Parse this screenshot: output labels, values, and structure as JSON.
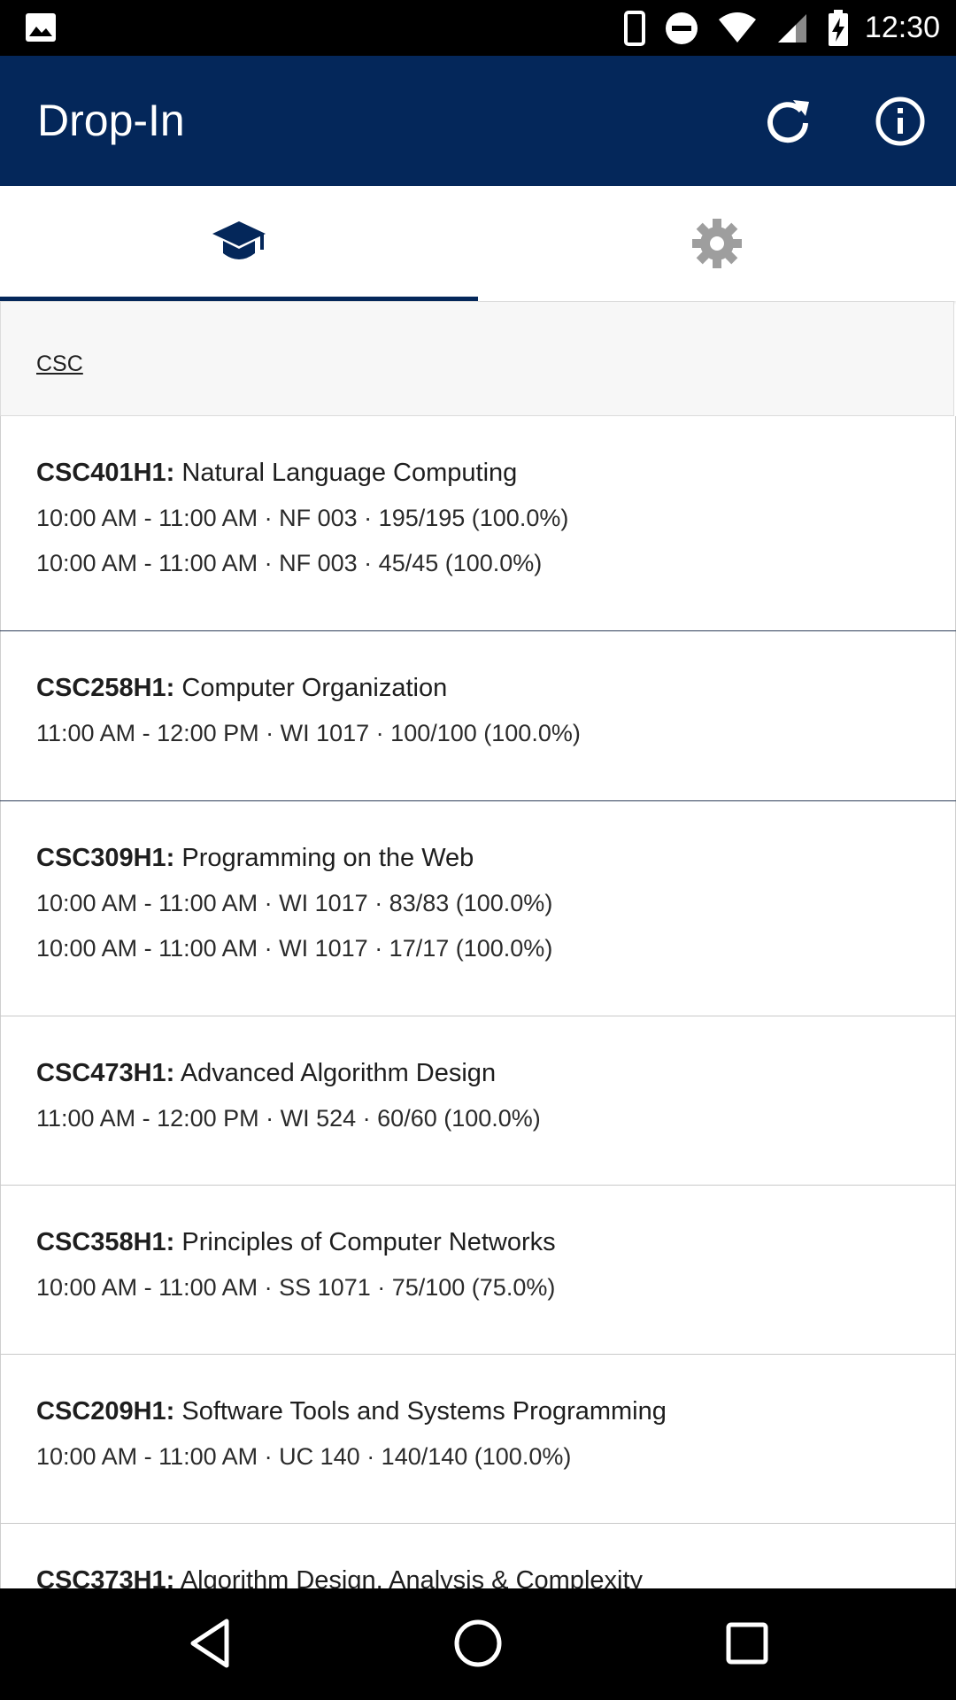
{
  "status_bar": {
    "time": "12:30",
    "icons": [
      "gallery-icon",
      "phone-icon",
      "do-not-disturb-icon",
      "wifi-icon",
      "signal-icon",
      "battery-charging-icon"
    ]
  },
  "app_bar": {
    "title": "Drop-In",
    "actions": [
      "refresh-icon",
      "info-icon"
    ],
    "color": "#04275a"
  },
  "tabs": [
    {
      "icon": "graduation-cap-icon",
      "selected": true
    },
    {
      "icon": "gear-icon",
      "selected": false
    }
  ],
  "section": {
    "label": "CSC"
  },
  "courses": [
    {
      "code": "CSC401H1:",
      "name": "Natural Language Computing",
      "sessions": [
        "10:00 AM - 11:00 AM · NF 003 · 195/195 (100.0%)",
        "10:00 AM - 11:00 AM · NF 003 · 45/45 (100.0%)"
      ]
    },
    {
      "code": "CSC258H1:",
      "name": "Computer Organization",
      "sessions": [
        "11:00 AM - 12:00 PM · WI 1017 · 100/100 (100.0%)"
      ]
    },
    {
      "code": "CSC309H1:",
      "name": "Programming on the Web",
      "sessions": [
        "10:00 AM - 11:00 AM · WI 1017 · 83/83 (100.0%)",
        "10:00 AM - 11:00 AM · WI 1017 · 17/17 (100.0%)"
      ]
    },
    {
      "code": "CSC473H1:",
      "name": "Advanced Algorithm Design",
      "sessions": [
        "11:00 AM - 12:00 PM · WI 524 · 60/60 (100.0%)"
      ]
    },
    {
      "code": "CSC358H1:",
      "name": "Principles of Computer Networks",
      "sessions": [
        "10:00 AM - 11:00 AM · SS 1071 · 75/100 (75.0%)"
      ]
    },
    {
      "code": "CSC209H1:",
      "name": "Software Tools and Systems Programming",
      "sessions": [
        "10:00 AM - 11:00 AM · UC 140 · 140/140 (100.0%)"
      ]
    },
    {
      "code": "CSC373H1:",
      "name": "Algorithm Design, Analysis & Complexity",
      "sessions": []
    }
  ],
  "nav_bar": {
    "buttons": [
      "back-icon",
      "home-icon",
      "recents-icon"
    ]
  }
}
